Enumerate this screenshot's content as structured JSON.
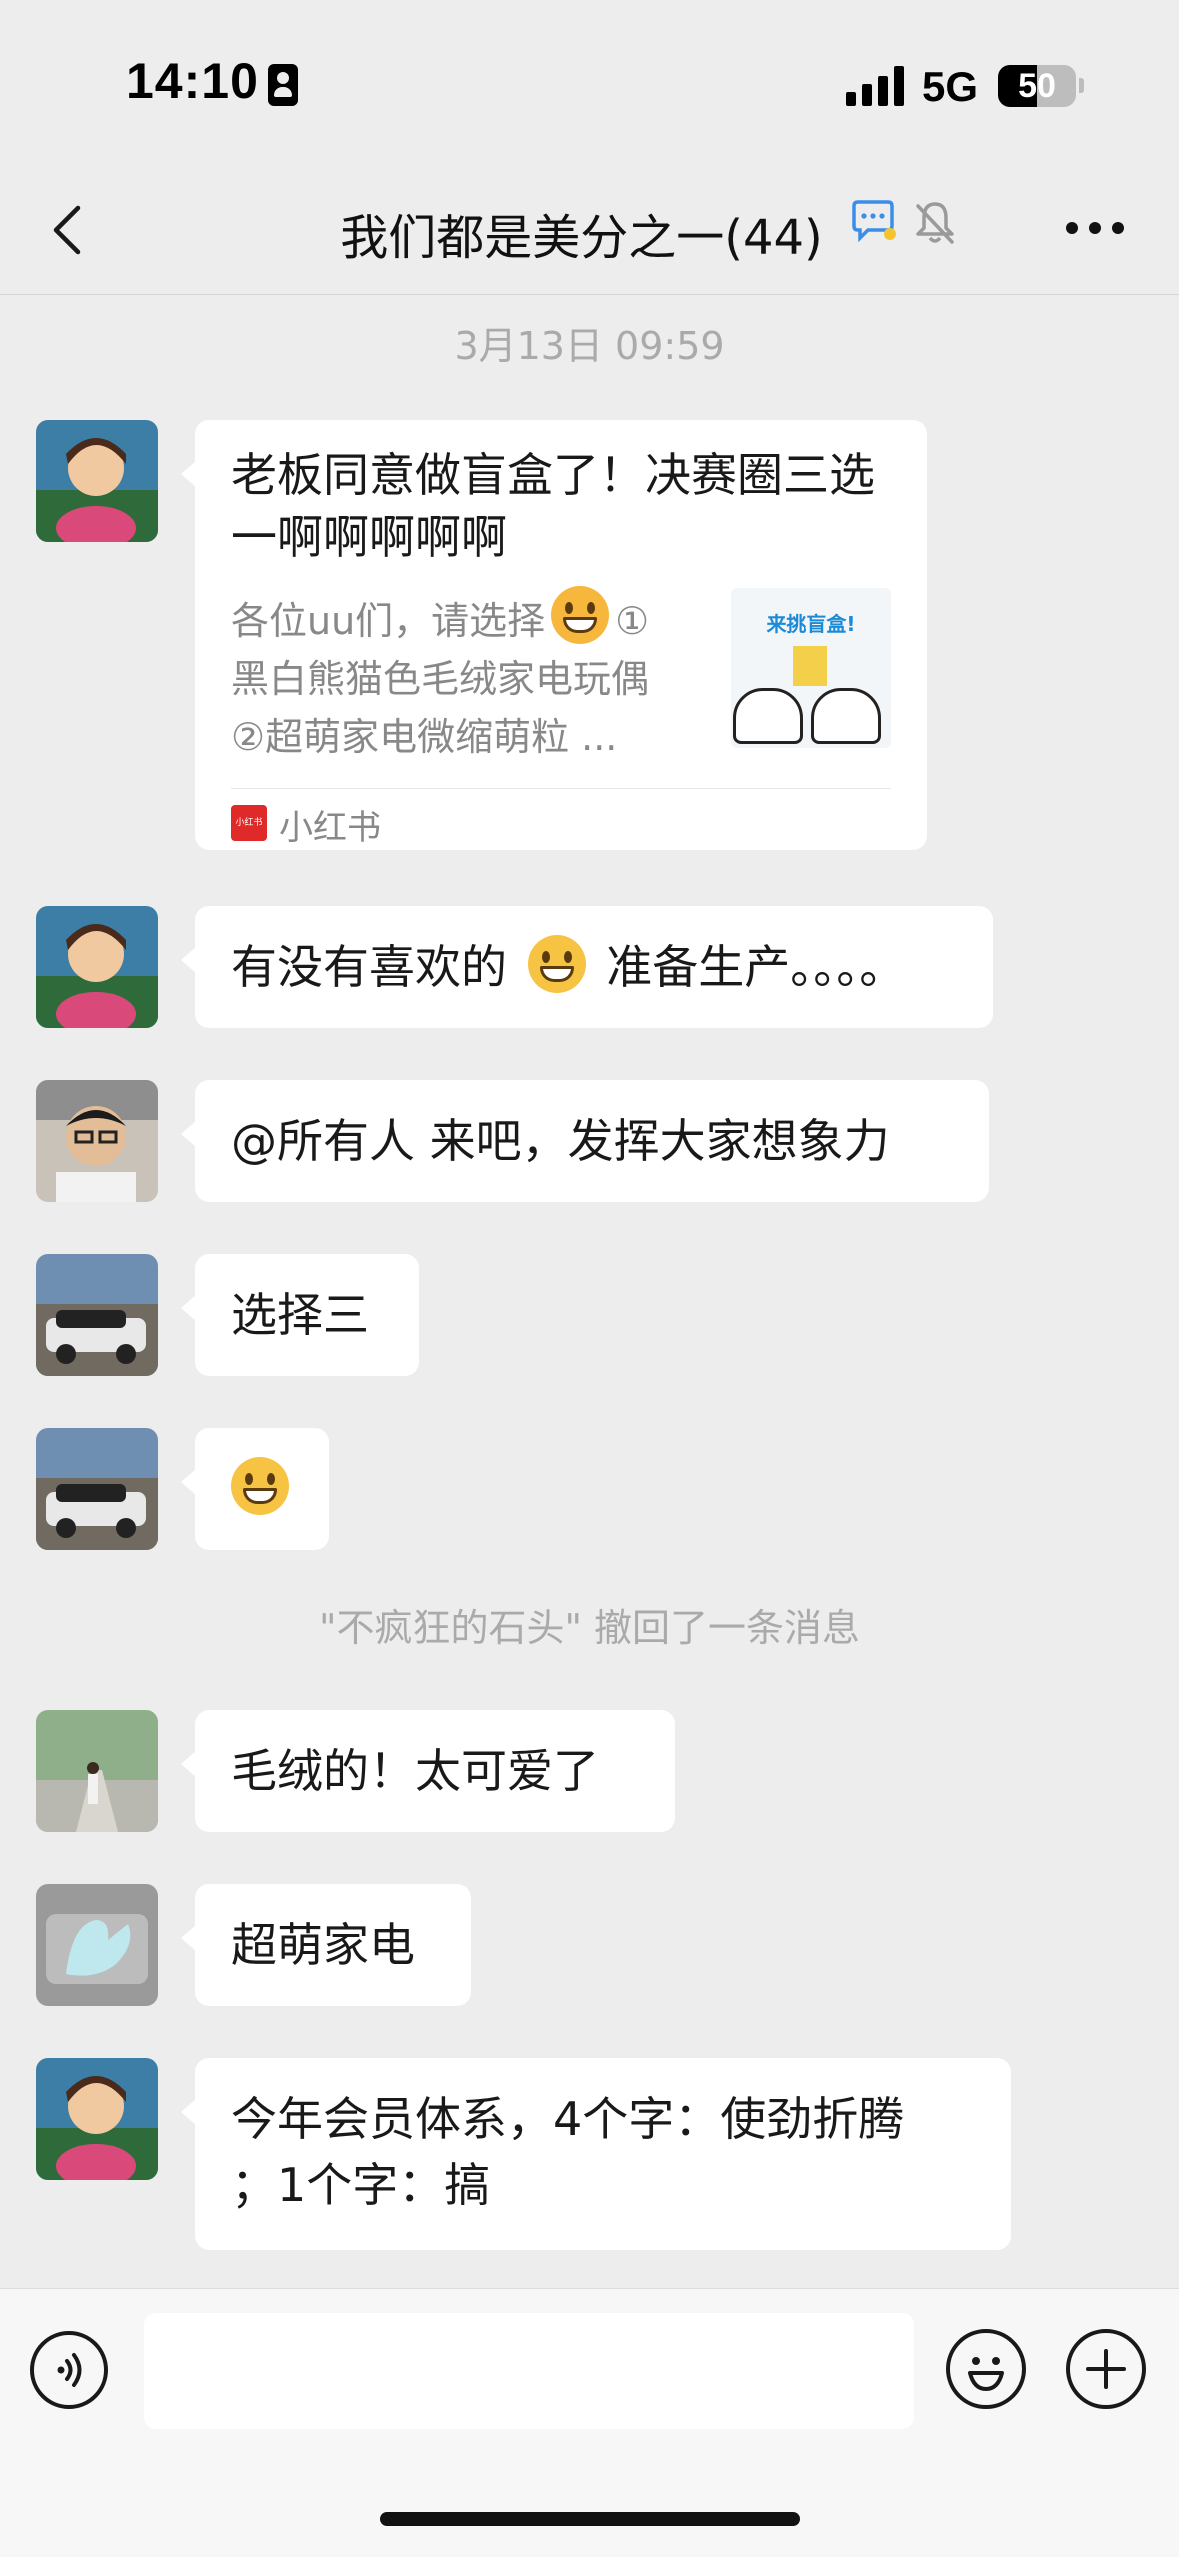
{
  "status_bar": {
    "time": "14:10",
    "network": "5G",
    "battery": "50",
    "battery_level": 0.5
  },
  "nav": {
    "title": "我们都是美分之一(44)"
  },
  "chat": {
    "timestamp": "3月13日 09:59",
    "card": {
      "title": "老板同意做盲盒了！决赛圈三选一啊啊啊啊啊",
      "desc_line1": "各位uu们，请选择",
      "desc_line1_tail": "①",
      "desc_line2": "黑白熊猫色毛绒家电玩偶",
      "desc_line3": "②超萌家电微缩萌粒 ...",
      "thumb_text": "来挑盲盒!",
      "source_logo": "小红书",
      "source": "小红书"
    },
    "messages": [
      {
        "text_a": "有没有喜欢的",
        "text_b": "准备生产。。。。"
      },
      {
        "text": "@所有人 来吧，发挥大家想象力"
      },
      {
        "text": "选择三"
      },
      {
        "text": ""
      }
    ],
    "recall_notice": "\"不疯狂的石头\" 撤回了一条消息",
    "messages2": [
      {
        "text": "毛绒的！太可爱了"
      },
      {
        "text": "超萌家电"
      },
      {
        "text_line1": "今年会员体系，4个字：使劲折腾",
        "text_line2": "；1个字：搞"
      }
    ]
  }
}
